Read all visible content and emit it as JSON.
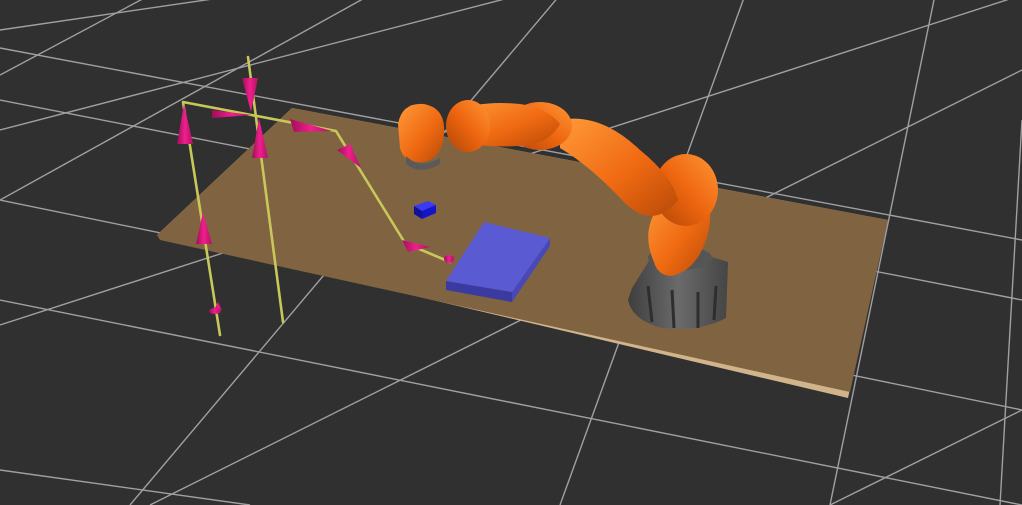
{
  "scene": {
    "background_color": "#303030",
    "grid_color": "#a0a0a4",
    "table_top_color": "#806442",
    "table_edge_color": "#d2b48c",
    "robot_color": "#f06a12",
    "robot_base_color": "#5a5a5a",
    "trajectory_line_color": "#c8c85a",
    "waypoint_marker_color": "#e0157f",
    "target_cube_color": "#1414c8",
    "placement_box_color": "#5a5ad2"
  },
  "objects": [
    {
      "name": "ground-grid",
      "type": "grid"
    },
    {
      "name": "table",
      "type": "plane"
    },
    {
      "name": "trajectory-path",
      "type": "line-strip"
    },
    {
      "name": "waypoint-markers",
      "type": "arrow-markers"
    },
    {
      "name": "target-cube",
      "type": "cube"
    },
    {
      "name": "placement-box",
      "type": "box"
    },
    {
      "name": "robot-arm",
      "type": "manipulator"
    }
  ]
}
